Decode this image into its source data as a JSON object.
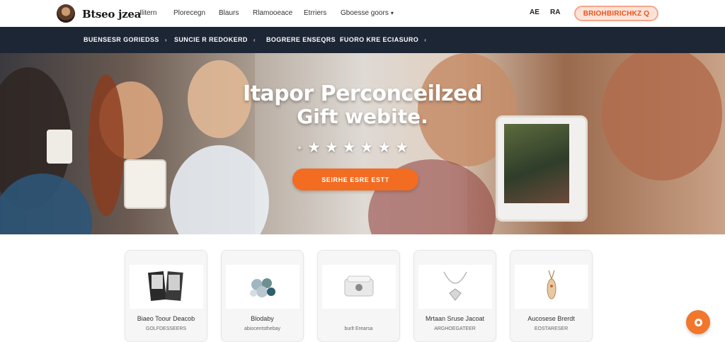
{
  "header": {
    "logo_text": "Btseo jzea",
    "nav": [
      {
        "label": "Ilitern",
        "dropdown": false
      },
      {
        "label": "Plorecegn",
        "dropdown": false
      },
      {
        "label": "Blaurs",
        "dropdown": false
      },
      {
        "label": "Rlamooeace",
        "dropdown": false
      },
      {
        "label": "Etrriers",
        "dropdown": false
      },
      {
        "label": "Gboesse goors",
        "dropdown": true
      }
    ],
    "lang": [
      "AE",
      "RA"
    ],
    "cta_label": "BRIOHBIRICHKZ Q"
  },
  "categories": [
    {
      "label": "BUENSESR  GORIEDSS",
      "chevron": "›"
    },
    {
      "label": "SUNCIE R REDOKERD",
      "chevron": "‹"
    },
    {
      "label": "BOGRERE ENSEQRS",
      "chevron": "‹"
    },
    {
      "label": "FUORO KRE ECIASURO",
      "chevron": "‹"
    }
  ],
  "hero": {
    "title_line1": "Itapor Perconceilzed",
    "title_line2": "Gift webite.",
    "rating_stars": 6,
    "button_label": "SEIRHE ESRE ESTT"
  },
  "products": [
    {
      "name": "Biaeo Toour Deacob",
      "sub": "GOLFDESSEERS"
    },
    {
      "name": "Blodaby",
      "sub": "abiocentsthebay"
    },
    {
      "name": "",
      "sub": "burlt Erearsa"
    },
    {
      "name": "Mrtaan Sruse Jacoat",
      "sub": "ARGHOEGATEER"
    },
    {
      "name": "Aucosese Brerdt",
      "sub": "EOSTARESER"
    }
  ],
  "colors": {
    "accent": "#f26c22",
    "navbar": "#1d2634"
  }
}
